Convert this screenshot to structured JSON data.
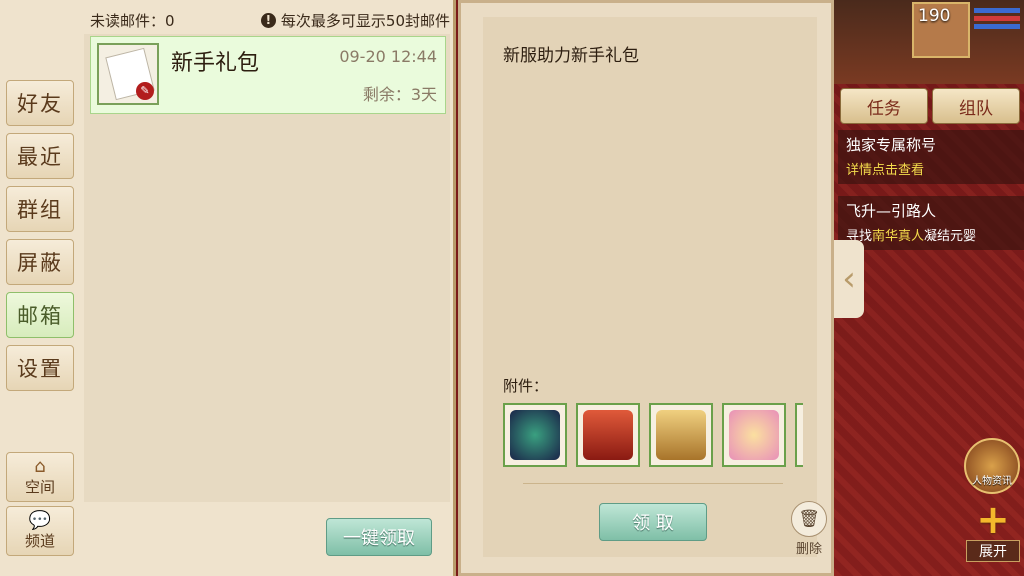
{
  "side_tabs": [
    "好友",
    "最近",
    "群组",
    "屏蔽",
    "邮箱",
    "设置"
  ],
  "active_tab": "邮箱",
  "side_bottom": [
    {
      "icon": "home-icon",
      "label": "空间"
    },
    {
      "icon": "chat-icon",
      "label": "频道"
    }
  ],
  "mail_list": {
    "unread_label": "未读邮件：",
    "unread_count": "0",
    "notice": "每次最多可显示50封邮件",
    "items": [
      {
        "title": "新手礼包",
        "date": "09-20 12:44",
        "remaining": "剩余：3天"
      }
    ],
    "claim_all_label": "一键领取"
  },
  "detail": {
    "title": "新服助力新手礼包",
    "attachments_label": "附件：",
    "attachments": [
      {
        "name": "dragon-icon",
        "color": "#2b3a6a"
      },
      {
        "name": "gift-box-icon",
        "color": "#c0392b"
      },
      {
        "name": "treasure-chest-icon",
        "color": "#c8a040"
      },
      {
        "name": "scroll-item-icon",
        "color": "#e6a0c0"
      }
    ],
    "claim_label": "领 取",
    "delete_label": "删除"
  },
  "game_hud": {
    "level": "190",
    "task_label": "任务",
    "team_label": "组队",
    "quests": [
      {
        "title": "独家专属称号",
        "desc_plain": "详情点击查看",
        "desc_prefix": "",
        "desc_highlight": "",
        "desc_suffix": ""
      },
      {
        "title": "飞升—引路人",
        "desc_plain": "",
        "desc_prefix": "寻找",
        "desc_highlight": "南华真人",
        "desc_suffix": "凝结元婴"
      }
    ],
    "char_info_label": "人物资讯",
    "expand_label": "展开"
  },
  "colors": {
    "accent_green": "#8fbf6a",
    "claim_button": "#7fbfa7",
    "quest_highlight": "#f4dc4c",
    "panel_bg": "#efe3cd"
  }
}
